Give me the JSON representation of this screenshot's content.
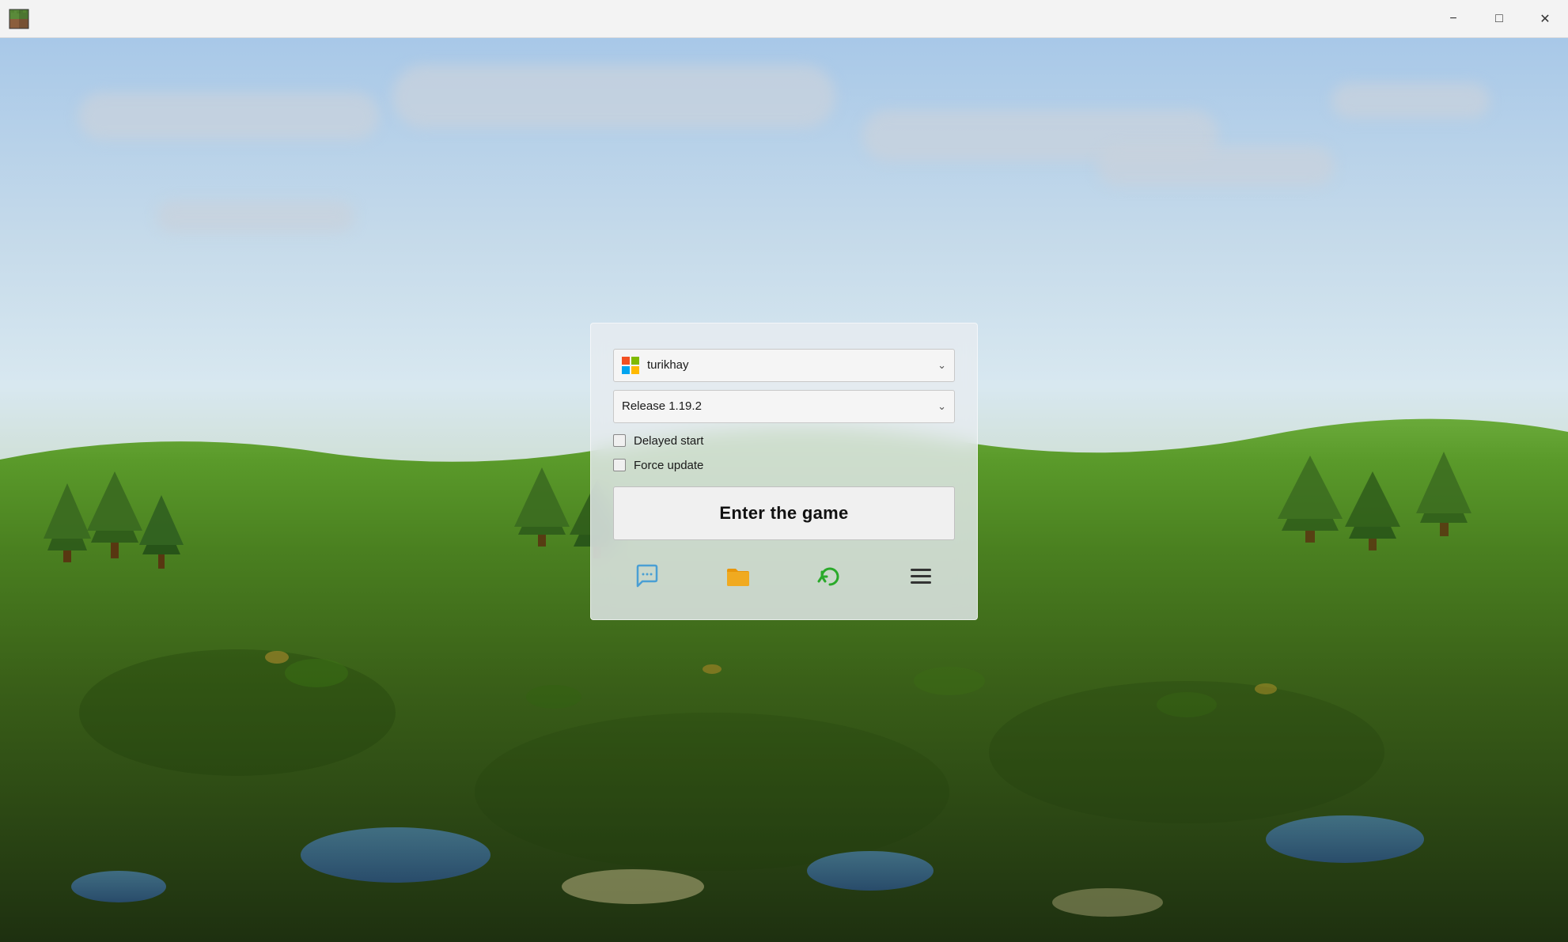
{
  "titlebar": {
    "app_icon": "minecraft-block-icon",
    "minimize_label": "−",
    "maximize_label": "□",
    "close_label": "✕"
  },
  "dialog": {
    "account": {
      "name": "turikhay",
      "dropdown_arrow": "∨"
    },
    "version": {
      "value": "Release 1.19.2",
      "dropdown_arrow": "∨"
    },
    "checkboxes": {
      "delayed_start": {
        "label": "Delayed start",
        "checked": false
      },
      "force_update": {
        "label": "Force update",
        "checked": false
      }
    },
    "enter_game_button": "Enter the game",
    "icons": {
      "chat": "chat-icon",
      "folder": "folder-icon",
      "refresh": "refresh-icon",
      "menu": "menu-icon"
    }
  },
  "background": {
    "type": "minecraft-landscape",
    "sky_color": "#a8c8e8",
    "terrain_color": "#5a8a3a"
  }
}
